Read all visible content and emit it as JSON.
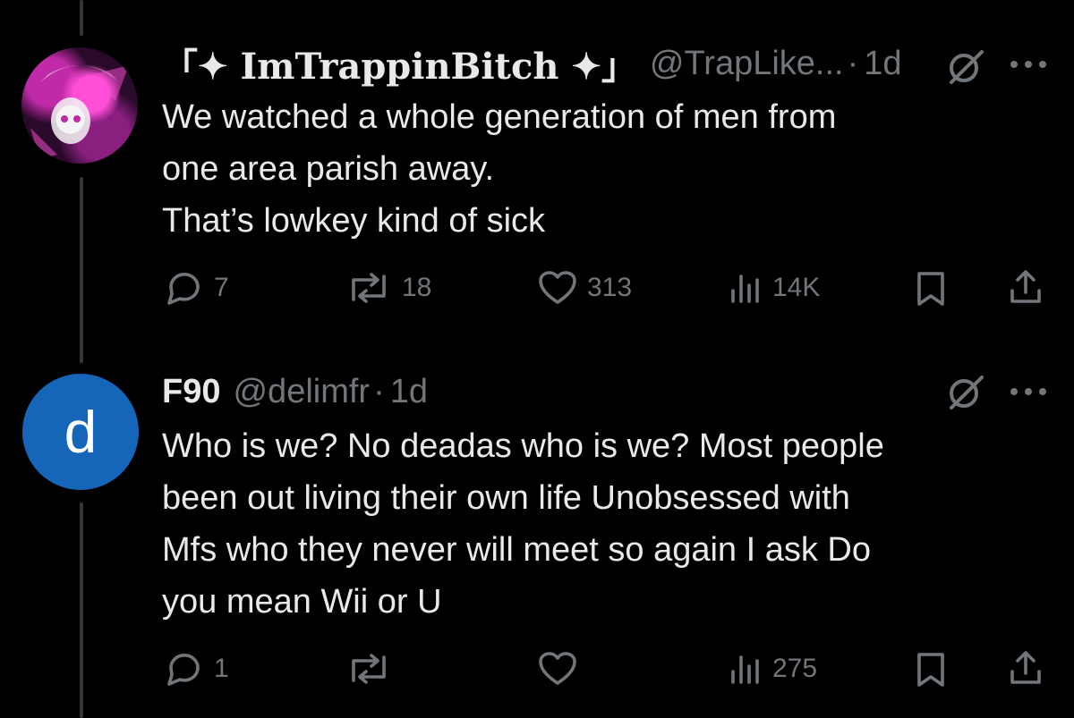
{
  "tweets": [
    {
      "display_name": "「✦ ImTrappinBitch ✦」",
      "handle": "@TrapLike...",
      "dot": "·",
      "time": "1d",
      "text_lines": [
        "We watched a whole generation of men from",
        "one area parish away.",
        "That’s lowkey kind of sick"
      ],
      "stats": {
        "replies": "7",
        "reposts": "18",
        "likes": "313",
        "views": "14K"
      },
      "avatar_icon": "anime-avatar"
    },
    {
      "display_name": "F90",
      "handle": "@delimfr",
      "dot": "·",
      "time": "1d",
      "avatar_letter": "d",
      "text_lines": [
        "Who is we? No deadas who is we? Most people",
        "been out living their own life Unobsessed with",
        "Mfs who they never will meet so again I ask Do",
        "you mean Wii or U"
      ],
      "stats": {
        "replies": "1",
        "reposts": "",
        "likes": "",
        "views": "275"
      }
    }
  ],
  "colors": {
    "background": "#000000",
    "text": "#e7e9ea",
    "muted": "#71767b",
    "avatar_blue": "#1565b8"
  }
}
